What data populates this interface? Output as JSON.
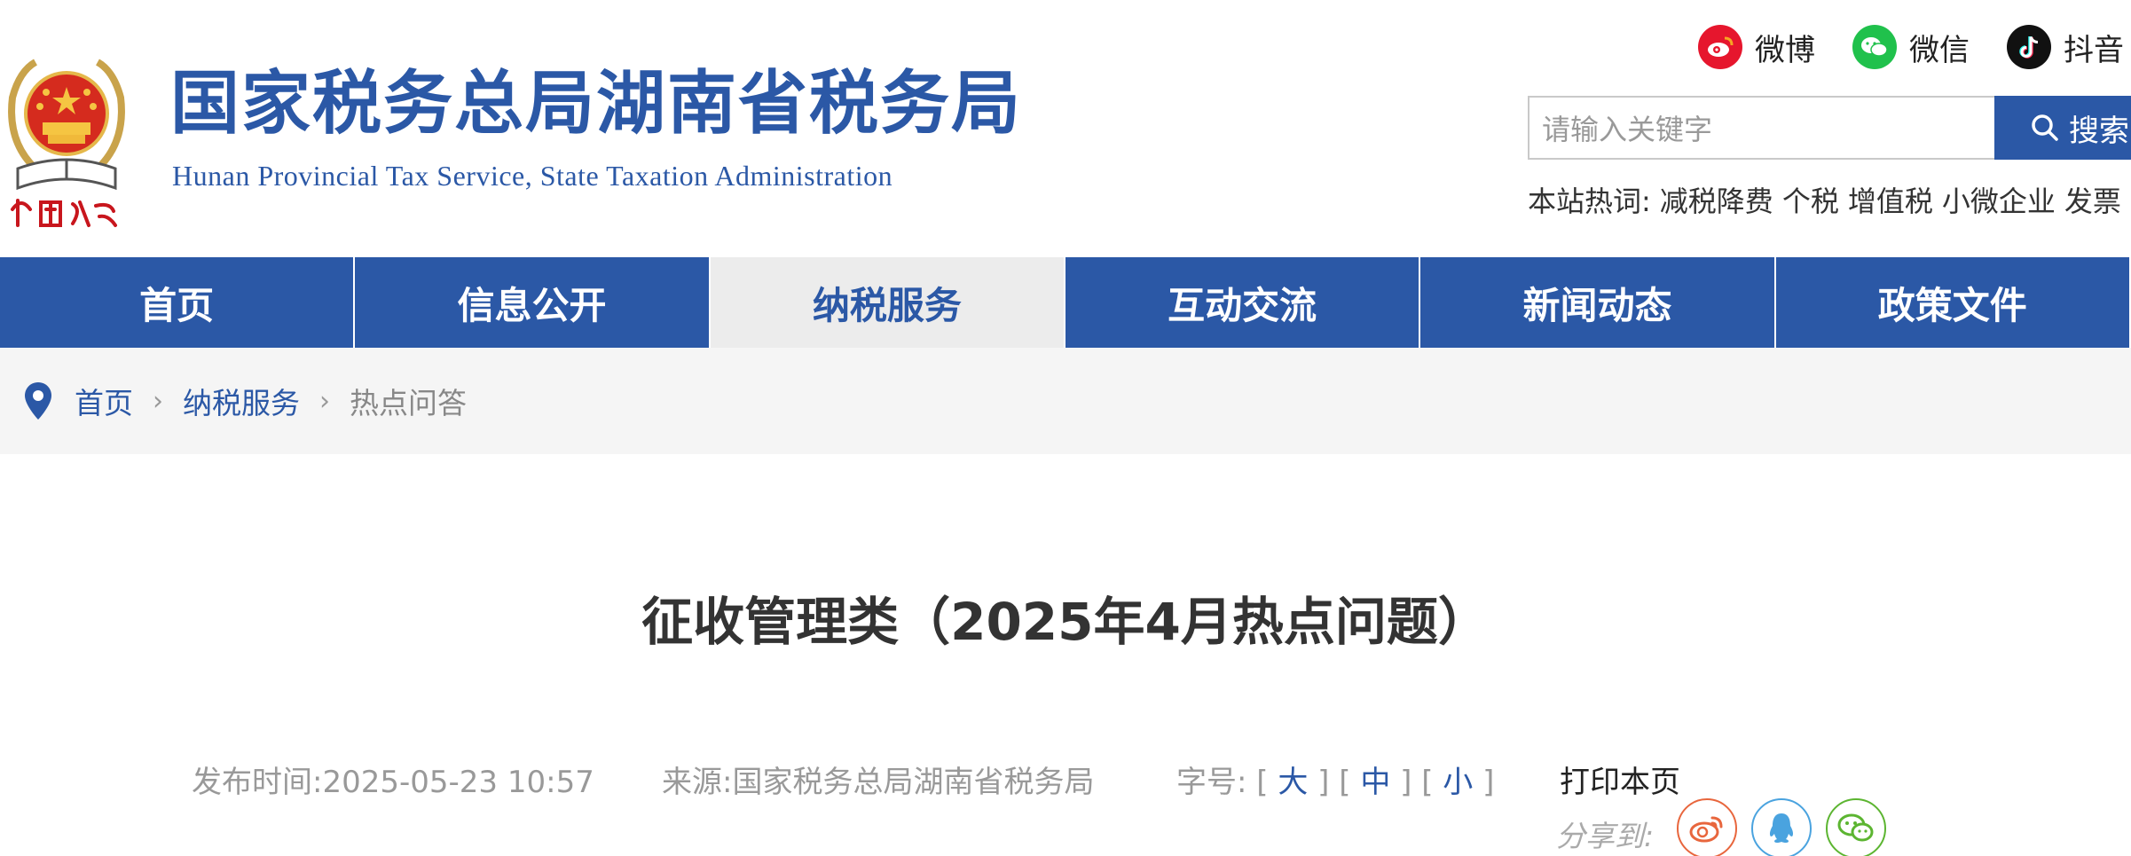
{
  "header": {
    "site_title": "国家税务总局湖南省税务局",
    "site_subtitle": "Hunan Provincial  Tax Service,  State Taxation Administration",
    "emblem_caption": "中国税务",
    "social": [
      {
        "label": "微博",
        "icon": "weibo-icon",
        "color": "#e6162d"
      },
      {
        "label": "微信",
        "icon": "wechat-icon",
        "color": "#20c14c"
      },
      {
        "label": "抖音",
        "icon": "douyin-icon",
        "color": "#111111"
      }
    ],
    "search": {
      "placeholder": "请输入关键字",
      "button_label": "搜索"
    },
    "hotwords": {
      "label": "本站热词:",
      "items": [
        "减税降费",
        "个税",
        "增值税",
        "小微企业",
        "发票"
      ]
    }
  },
  "nav": {
    "items": [
      {
        "label": "首页",
        "active": false
      },
      {
        "label": "信息公开",
        "active": false
      },
      {
        "label": "纳税服务",
        "active": true
      },
      {
        "label": "互动交流",
        "active": false
      },
      {
        "label": "新闻动态",
        "active": false
      },
      {
        "label": "政策文件",
        "active": false
      }
    ]
  },
  "breadcrumb": {
    "items": [
      "首页",
      "纳税服务",
      "热点问答"
    ]
  },
  "article": {
    "title": "征收管理类（2025年4月热点问题）",
    "publish_label": "发布时间:",
    "publish_time": "2025-05-23 10:57",
    "source_label": "来源:",
    "source": "国家税务总局湖南省税务局",
    "font_size_label": "字号:",
    "font_sizes": [
      "大",
      "中",
      "小"
    ],
    "print_label": "打印本页",
    "share_label": "分享到:"
  },
  "colors": {
    "brand_blue": "#2b58a6",
    "nav_active_bg": "#ececec",
    "breadcrumb_bg": "#f5f5f5"
  }
}
